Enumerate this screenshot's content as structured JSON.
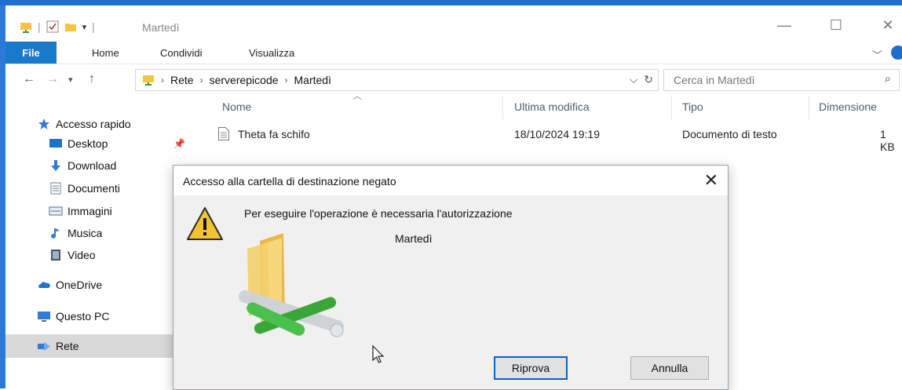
{
  "window": {
    "title": "Martedì",
    "controls": {
      "minimize": "—",
      "maximize": "☐",
      "close": "✕"
    }
  },
  "ribbon": {
    "file": "File",
    "tabs": [
      "Home",
      "Condividi",
      "Visualizza"
    ]
  },
  "address": {
    "crumbs": [
      "Rete",
      "serverepicode",
      "Martedì"
    ],
    "search_placeholder": "Cerca in Martedì"
  },
  "nav": {
    "items": [
      {
        "label": "Accesso rapido",
        "icon": "star-icon"
      },
      {
        "label": "Desktop",
        "icon": "desktop-icon",
        "pinned": true
      },
      {
        "label": "Download",
        "icon": "download-icon"
      },
      {
        "label": "Documenti",
        "icon": "documents-icon"
      },
      {
        "label": "Immagini",
        "icon": "pictures-icon"
      },
      {
        "label": "Musica",
        "icon": "music-icon"
      },
      {
        "label": "Video",
        "icon": "video-icon"
      },
      {
        "label": "OneDrive",
        "icon": "onedrive-icon"
      },
      {
        "label": "Questo PC",
        "icon": "pc-icon"
      },
      {
        "label": "Rete",
        "icon": "network-icon",
        "selected": true
      }
    ]
  },
  "files": {
    "columns": [
      "Nome",
      "Ultima modifica",
      "Tipo",
      "Dimensione"
    ],
    "rows": [
      {
        "name": "Theta fa schifo",
        "modified": "18/10/2024 19:19",
        "type": "Documento di testo",
        "size": "1 KB"
      }
    ]
  },
  "dialog": {
    "title": "Accesso alla cartella di destinazione negato",
    "message": "Per eseguire l'operazione è necessaria l'autorizzazione",
    "folder": "Martedì",
    "retry": "Riprova",
    "cancel": "Annulla"
  },
  "colors": {
    "accent": "#1979ca",
    "selection": "#d9d9d9",
    "warning": "#f2c230"
  }
}
